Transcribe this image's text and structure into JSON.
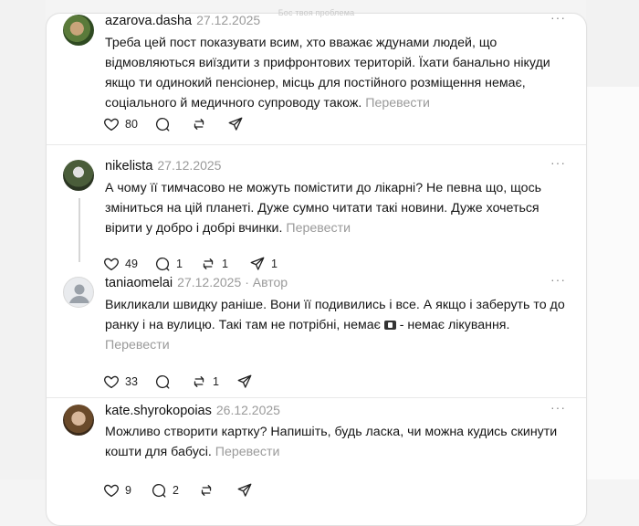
{
  "top_hint": "Бос твоя проблема",
  "translate_label": "Перевести",
  "posts": [
    {
      "username": "azarova.dasha",
      "date": "27.12.2025",
      "author_tag": "",
      "text": "Треба цей пост показувати всим, хто вважає ждунами людей, що відмовляються виїздити з прифронтових територій. Їхати банально нікуди якщо ти одинокий пенсіонер, місць для постійного розміщення немає, соціального й медичного супроводу також.",
      "likes": "80",
      "replies": "",
      "reposts": "",
      "shares": "",
      "avatar_icon": "user-photo"
    },
    {
      "username": "nikelista",
      "date": "27.12.2025",
      "author_tag": "",
      "text": "А чому її тимчасово не можуть помістити до лікарні? Не певна що, щось зміниться на цій планеті. Дуже сумно читати такі новини. Дуже хочеться вірити у добро і добрі вчинки.",
      "likes": "49",
      "replies": "1",
      "reposts": "1",
      "shares": "1",
      "avatar_icon": "user-photo"
    },
    {
      "username": "taniaomelai",
      "date": "27.12.2025",
      "author_tag": "· Автор",
      "text_part1": "Викликали швидку раніше. Вони її подивились і все. А якщо і заберуть то до ранку і на вулицю. Такі там не потрібні, немає",
      "text_part2": " - немає лікування.",
      "likes": "33",
      "replies": "",
      "reposts": "1",
      "shares": "",
      "avatar_icon": "default-avatar-icon"
    },
    {
      "username": "kate.shyrokopoias",
      "date": "26.12.2025",
      "author_tag": "",
      "text": "Можливо створити картку? Напишіть, будь ласка, чи можна кудись скинути кошти для бабусі.",
      "likes": "9",
      "replies": "2",
      "reposts": "",
      "shares": "",
      "avatar_icon": "user-photo"
    }
  ],
  "icons": {
    "like": "heart-icon",
    "reply": "comment-icon",
    "repost": "repost-icon",
    "share": "share-icon",
    "more": "more-icon",
    "money": "money-emoji-icon"
  },
  "colors": {
    "background": "#f4f4f4",
    "card": "#ffffff",
    "muted": "#9a9a9a",
    "divider": "#e9e9e9"
  }
}
